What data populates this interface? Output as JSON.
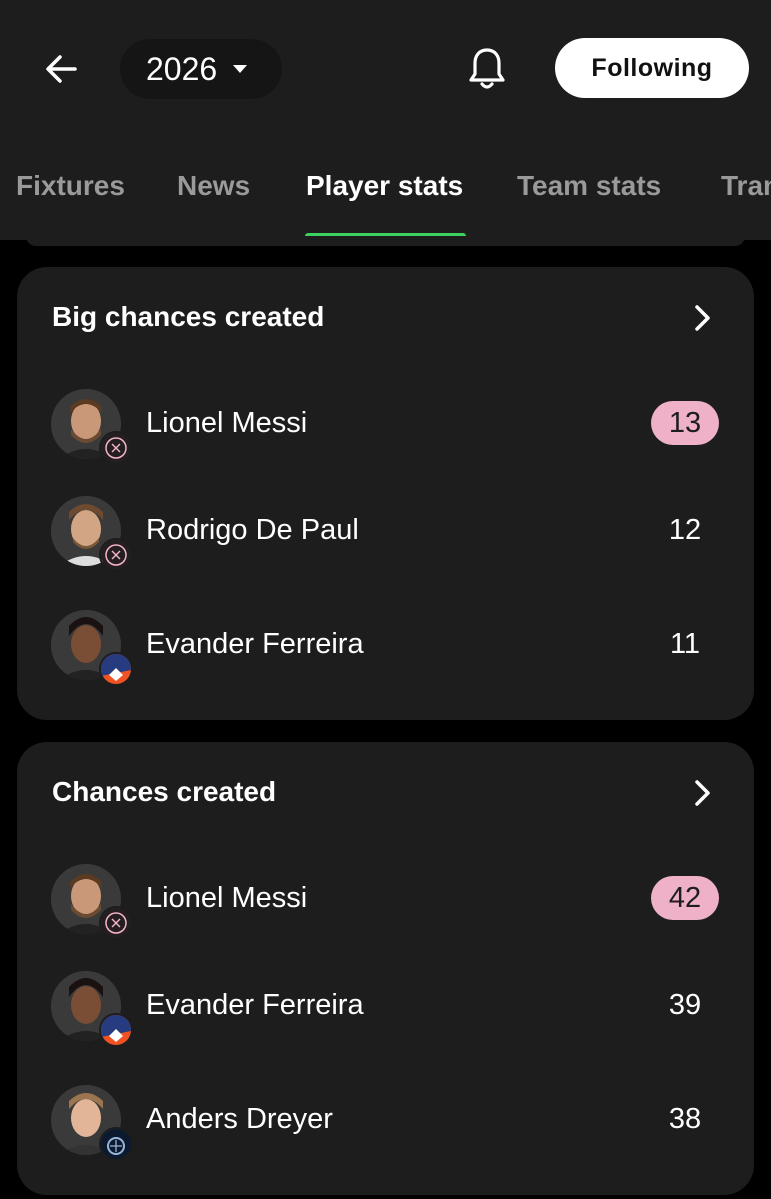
{
  "header": {
    "season": "2026",
    "follow_label": "Following"
  },
  "tabs": [
    {
      "label": "Fixtures"
    },
    {
      "label": "News"
    },
    {
      "label": "Player stats"
    },
    {
      "label": "Team stats"
    },
    {
      "label": "Transfers"
    }
  ],
  "active_tab": "Player stats",
  "colors": {
    "background": "#000000",
    "card": "#1d1d1d",
    "tab_indicator": "#3bd15f",
    "leader_pill": "#eeb1c8",
    "follow_button": "#ffffff"
  },
  "sections": [
    {
      "title": "Big chances created",
      "players": [
        {
          "name": "Lionel Messi",
          "value": "13",
          "leader": true,
          "team_badge": "inter-miami-badge"
        },
        {
          "name": "Rodrigo De Paul",
          "value": "12",
          "leader": false,
          "team_badge": "inter-miami-badge"
        },
        {
          "name": "Evander Ferreira",
          "value": "11",
          "leader": false,
          "team_badge": "fc-cincinnati-badge"
        }
      ]
    },
    {
      "title": "Chances created",
      "players": [
        {
          "name": "Lionel Messi",
          "value": "42",
          "leader": true,
          "team_badge": "inter-miami-badge"
        },
        {
          "name": "Evander Ferreira",
          "value": "39",
          "leader": false,
          "team_badge": "fc-cincinnati-badge"
        },
        {
          "name": "Anders Dreyer",
          "value": "38",
          "leader": false,
          "team_badge": "san-diego-fc-badge"
        }
      ]
    }
  ]
}
